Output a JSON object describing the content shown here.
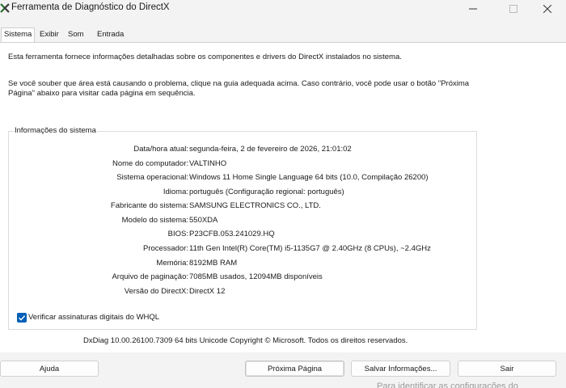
{
  "window": {
    "title": "Ferramenta de Diagnóstico do DirectX",
    "icon": "directx-x-icon"
  },
  "tabs": [
    {
      "label": "Sistema",
      "active": true
    },
    {
      "label": "Exibir",
      "active": false
    },
    {
      "label": "Som",
      "active": false
    },
    {
      "label": "Entrada",
      "active": false
    }
  ],
  "intro": {
    "line1": "Esta ferramenta fornece informações detalhadas sobre os componentes e drivers do DirectX instalados no sistema.",
    "line2": "Se você souber que área está causando o problema, clique na guia adequada acima. Caso contrário, você pode usar o botão \"Próxima Página\" abaixo para visitar cada página em sequência."
  },
  "system_info": {
    "legend": "Informações do sistema",
    "rows": [
      {
        "label": "Data/hora atual:",
        "value": "segunda-feira, 2 de fevereiro de 2026, 21:01:02"
      },
      {
        "label": "Nome do computador:",
        "value": "VALTINHO"
      },
      {
        "label": "Sistema operacional:",
        "value": "Windows 11 Home Single Language 64 bits (10.0, Compilação 26200)"
      },
      {
        "label": "Idioma:",
        "value": "português (Configuração regional: português)"
      },
      {
        "label": "Fabricante do sistema:",
        "value": "SAMSUNG ELECTRONICS CO., LTD."
      },
      {
        "label": "Modelo do sistema:",
        "value": "550XDA"
      },
      {
        "label": "BIOS:",
        "value": "P23CFB.053.241029.HQ"
      },
      {
        "label": "Processador:",
        "value": "11th Gen Intel(R) Core(TM) i5-1135G7 @ 2.40GHz (8 CPUs), ~2.4GHz"
      },
      {
        "label": "Memória:",
        "value": "8192MB RAM"
      },
      {
        "label": "Arquivo de paginação:",
        "value": "7085MB usados, 12094MB disponíveis"
      },
      {
        "label": "Versão do DirectX:",
        "value": "DirectX 12"
      }
    ],
    "whql_checkbox": {
      "label": "Verificar assinaturas digitais do WHQL",
      "checked": true
    }
  },
  "footer": {
    "copyright": "DxDiag 10.00.26100.7309 64 bits Unicode  Copyright © Microsoft. Todos os direitos reservados."
  },
  "buttons": {
    "help": "Ajuda",
    "next": "Próxima Página",
    "save": "Salvar Informações...",
    "exit": "Sair"
  },
  "bleed_text": "Para identificar as configurações do",
  "colors": {
    "accent": "#005fb8",
    "content_bg": "#ffffff",
    "chrome_bg": "#f3f3f3"
  }
}
